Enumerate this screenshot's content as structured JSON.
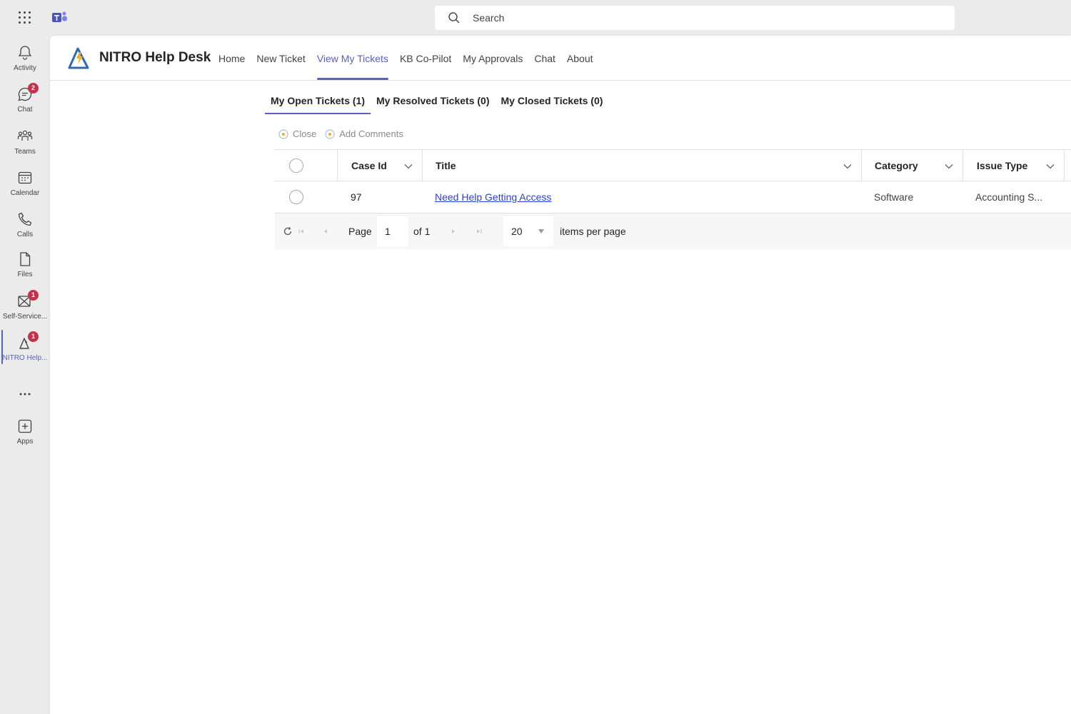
{
  "topbar": {
    "search_placeholder": "Search"
  },
  "rail": {
    "items": [
      {
        "label": "Activity",
        "icon": "bell-icon",
        "badge": ""
      },
      {
        "label": "Chat",
        "icon": "chat-icon",
        "badge": "2"
      },
      {
        "label": "Teams",
        "icon": "teams-icon",
        "badge": ""
      },
      {
        "label": "Calendar",
        "icon": "calendar-icon",
        "badge": ""
      },
      {
        "label": "Calls",
        "icon": "phone-icon",
        "badge": ""
      },
      {
        "label": "Files",
        "icon": "file-icon",
        "badge": ""
      },
      {
        "label": "Self-Service...",
        "icon": "self-service-icon",
        "badge": "1"
      },
      {
        "label": "NITRO Help...",
        "icon": "nitro-icon",
        "badge": "1"
      },
      {
        "label": "",
        "icon": "more-icon",
        "badge": ""
      },
      {
        "label": "Apps",
        "icon": "add-apps-icon",
        "badge": ""
      }
    ]
  },
  "app": {
    "title": "NITRO Help Desk",
    "nav": [
      "Home",
      "New Ticket",
      "View My Tickets",
      "KB Co-Pilot",
      "My Approvals",
      "Chat",
      "About"
    ],
    "active_nav": "View My Tickets"
  },
  "subtabs": [
    "My Open Tickets (1)",
    "My Resolved Tickets (0)",
    "My Closed Tickets (0)"
  ],
  "commands": [
    "Close",
    "Add Comments"
  ],
  "grid": {
    "columns": [
      "Case Id",
      "Title",
      "Category",
      "Issue Type"
    ],
    "rows": [
      {
        "case_id": "97",
        "title": "Need Help Getting Access",
        "category": "Software",
        "issue_type": "Accounting S..."
      }
    ]
  },
  "pager": {
    "page_label": "Page",
    "page": "1",
    "of_label": "of 1",
    "per_page": "20",
    "per_page_label": "items per page"
  },
  "colors": {
    "accent": "#5b5fc7",
    "badge": "#c4314b",
    "link": "#2b3fd3"
  }
}
